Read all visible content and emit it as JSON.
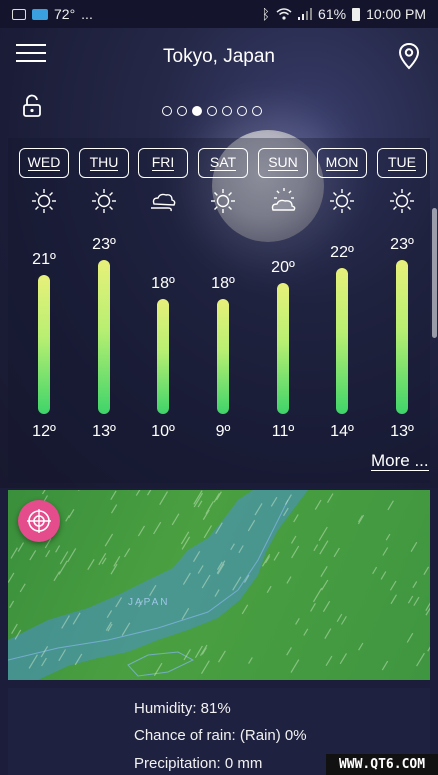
{
  "status_bar": {
    "temp": "72°",
    "ellipsis": "...",
    "battery": "61%",
    "time": "10:00 PM"
  },
  "header": {
    "city": "Tokyo, Japan"
  },
  "pager": {
    "count": 7,
    "active_index": 2
  },
  "forecast": [
    {
      "day": "WED",
      "icon": "sun-icon",
      "high": "21º",
      "low": "12º"
    },
    {
      "day": "THU",
      "icon": "sun-icon",
      "high": "23º",
      "low": "13º"
    },
    {
      "day": "FRI",
      "icon": "cloud-wind-icon",
      "high": "18º",
      "low": "10º"
    },
    {
      "day": "SAT",
      "icon": "sun-icon",
      "high": "18º",
      "low": "9º"
    },
    {
      "day": "SUN",
      "icon": "partly-cloudy-icon",
      "high": "20º",
      "low": "11º"
    },
    {
      "day": "MON",
      "icon": "sun-icon",
      "high": "22º",
      "low": "14º"
    },
    {
      "day": "TUE",
      "icon": "sun-icon",
      "high": "23º",
      "low": "13º"
    }
  ],
  "forecast_link": "More ...",
  "map": {
    "label": "JAPAN"
  },
  "details": {
    "humidity": "Humidity: 81%",
    "rain_chance": "Chance of rain: (Rain) 0%",
    "precipitation": "Precipitation: 0 mm"
  },
  "watermark": "WWW.QT6.COM",
  "colors": {
    "bar_top": "#e7f07a",
    "bar_bottom": "#3fd46a",
    "radar_button": "#e44c8c",
    "map_water": "#4a8fd0"
  }
}
